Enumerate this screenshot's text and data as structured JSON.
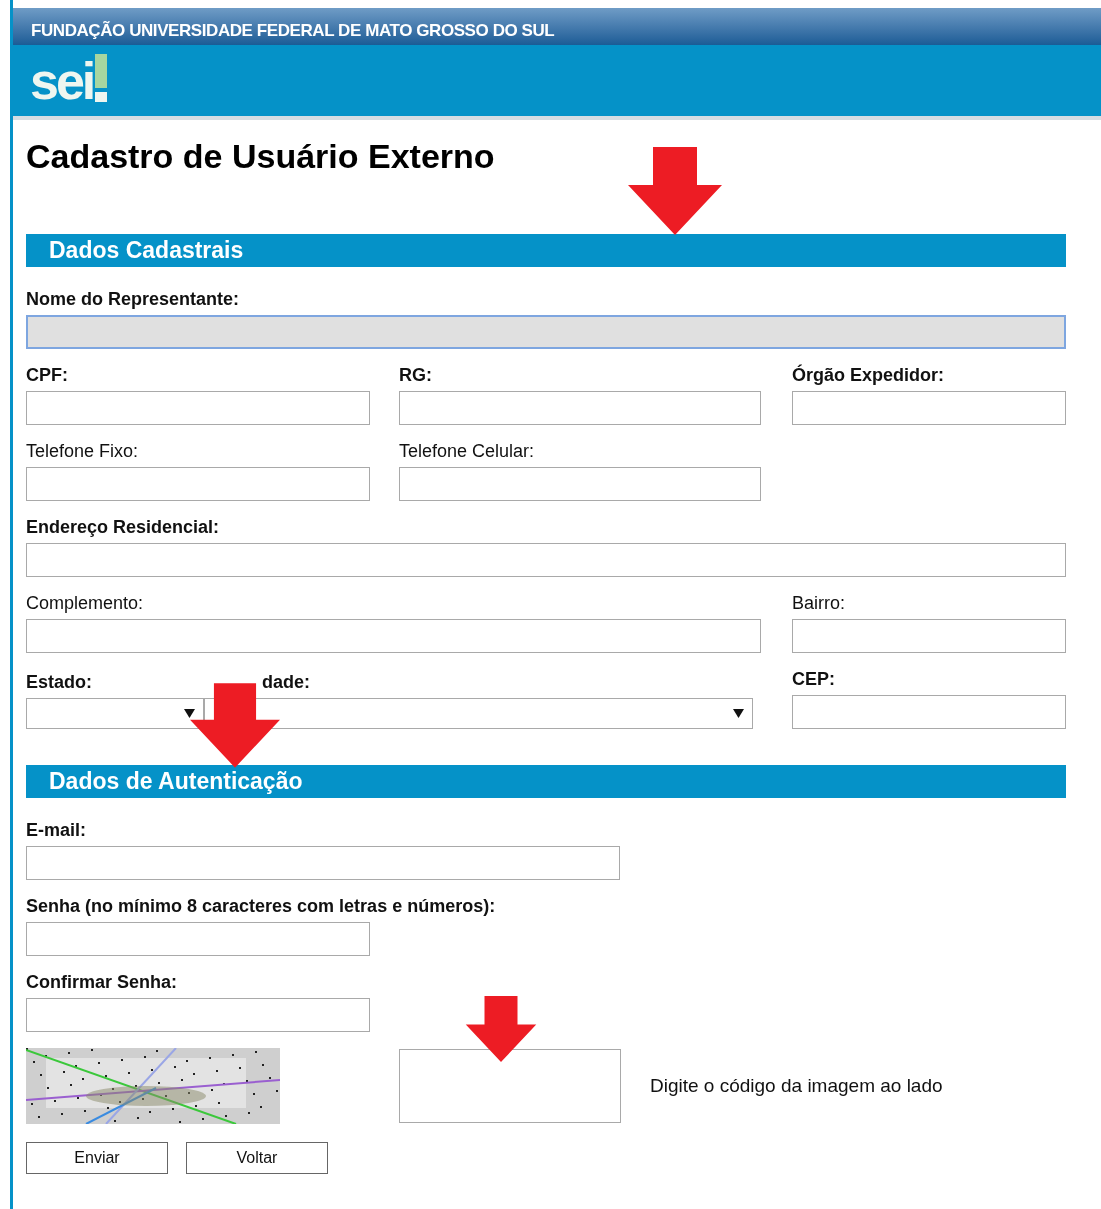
{
  "header": {
    "organization": "FUNDAÇÃO UNIVERSIDADE FEDERAL DE MATO GROSSO DO SUL",
    "logo": "sei"
  },
  "title": "Cadastro de Usuário Externo",
  "sections": [
    {
      "title": "Dados Cadastrais",
      "fields": [
        {
          "label": "Nome do Representante:",
          "bold": true,
          "kind": "text",
          "disabled": true
        },
        {
          "label": "CPF:",
          "bold": true,
          "kind": "text",
          "disabled": false
        },
        {
          "label": "RG:",
          "bold": true,
          "kind": "text",
          "disabled": false
        },
        {
          "label": "Órgão Expedidor:",
          "bold": true,
          "kind": "text",
          "disabled": false
        },
        {
          "label": "Telefone Fixo:",
          "bold": false,
          "kind": "text",
          "disabled": false
        },
        {
          "label": "Telefone Celular:",
          "bold": false,
          "kind": "text",
          "disabled": false
        },
        {
          "label": "Endereço Residencial:",
          "bold": true,
          "kind": "text",
          "disabled": false
        },
        {
          "label": "Complemento:",
          "bold": false,
          "kind": "text",
          "disabled": false
        },
        {
          "label": "Bairro:",
          "bold": false,
          "kind": "text",
          "disabled": false
        },
        {
          "label": "Estado:",
          "bold": true,
          "kind": "select",
          "disabled": false
        },
        {
          "label": "dade:",
          "bold": true,
          "kind": "select",
          "disabled": false
        },
        {
          "label": "CEP:",
          "bold": true,
          "kind": "text",
          "disabled": false
        }
      ]
    },
    {
      "title": "Dados de Autenticação",
      "fields": [
        {
          "label": "E-mail:",
          "bold": true,
          "kind": "text",
          "disabled": false
        },
        {
          "label": "Senha (no mínimo 8 caracteres com letras e números):",
          "bold": true,
          "kind": "password",
          "disabled": false
        },
        {
          "label": "Confirmar Senha:",
          "bold": true,
          "kind": "password",
          "disabled": false
        }
      ]
    }
  ],
  "captcha": {
    "hint": "Digite o código da imagem ao lado"
  },
  "buttons": [
    "Enviar",
    "Voltar"
  ]
}
